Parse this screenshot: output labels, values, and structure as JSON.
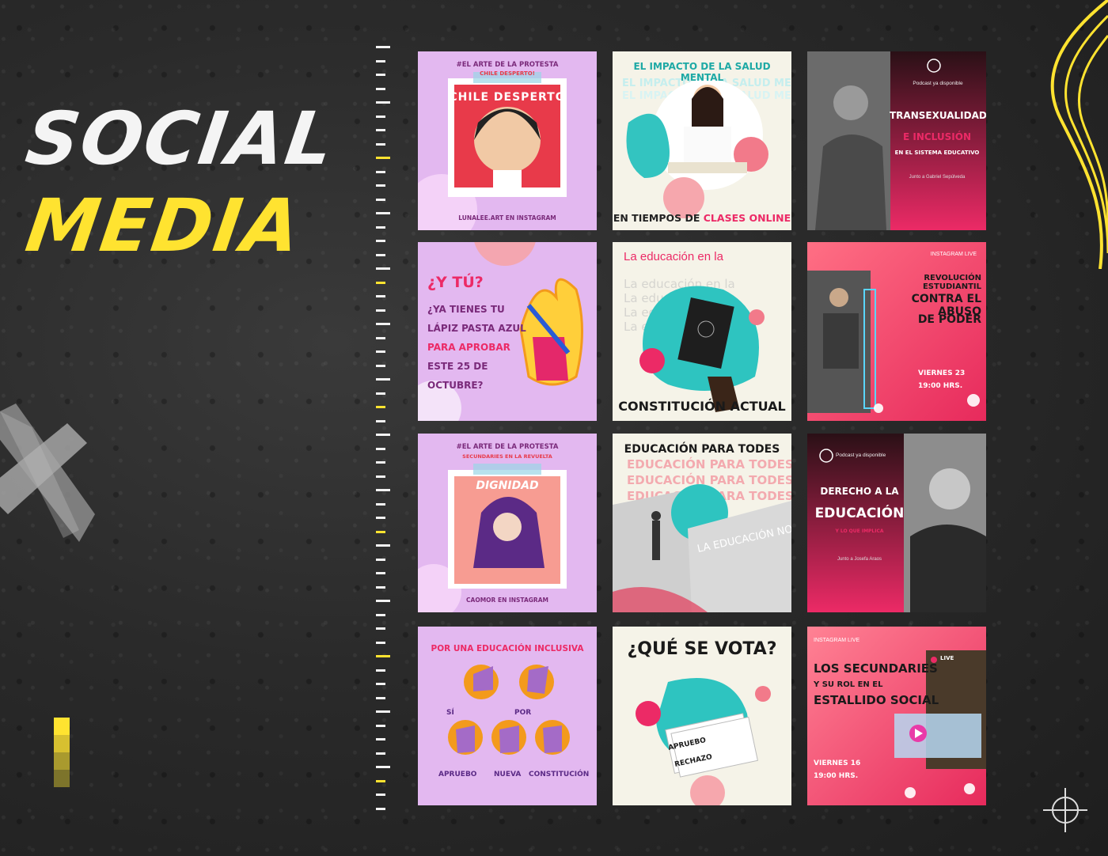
{
  "header": {
    "title_line1": "SOCIAL",
    "title_line2": "MEDIA"
  },
  "colors": {
    "accent_yellow": "#ffe330",
    "pink": "#ec2a66",
    "lilac": "#e6b4f0",
    "teal": "#2ec4c0",
    "cream": "#f5f3e8",
    "dark": "#1c1c1c"
  },
  "tiles": {
    "t1": {
      "hashtag": "#EL ARTE DE LA PROTESTA",
      "sub": "CHILE DESPERTO!",
      "art_text": "CHILE DESPERTO",
      "footer": "LUNALEE.ART EN INSTAGRAM"
    },
    "t2": {
      "headline": "EL IMPACTO DE LA SALUD MENTAL",
      "footer_a": "EN TIEMPOS DE ",
      "footer_b": "CLASES ONLINE"
    },
    "t3": {
      "badge": "Podcast ya disponible",
      "line1": "TRANSEXUALIDAD",
      "line2": "E INCLUSIÓN",
      "line3": "EN EL SISTEMA EDUCATIVO",
      "credit": "Junto a Gabriel Sepúlveda"
    },
    "t4": {
      "q": "¿Y TÚ?",
      "l1": "¿YA TIENES TU",
      "l2": "LÁPIZ PASTA AZUL",
      "l3": "PARA APROBAR",
      "l4": "ESTE 25 DE",
      "l5": "OCTUBRE?"
    },
    "t5": {
      "headline": "La educación en la",
      "footer": "CONSTITUCIÓN ACTUAL"
    },
    "t6": {
      "badge": "INSTAGRAM LIVE",
      "l1": "REVOLUCIÓN ESTUDIANTIL",
      "l2": "CONTRA EL ABUSO",
      "l3": "DE PODER",
      "date": "VIERNES 23",
      "time": "19:00 HRS."
    },
    "t7": {
      "hashtag": "#EL ARTE DE LA PROTESTA",
      "sub": "SECUNDARIES EN LA REVUELTA",
      "art_text": "DIGNIDAD",
      "footer": "CAOMOR EN INSTAGRAM"
    },
    "t8": {
      "headline": "EDUCACIÓN PARA TODES",
      "wall": "LA EDUCACIÓN NO SE VENDE"
    },
    "t9": {
      "badge": "Podcast ya disponible",
      "l1": "DERECHO A LA",
      "l2": "EDUCACIÓN",
      "l3": "Y LO QUE IMPLICA",
      "credit": "Junto a Josefa Araos"
    },
    "t10": {
      "headline": "POR UNA EDUCACIÓN INCLUSIVA",
      "signs": [
        "SÍ",
        "POR",
        "APRUEBO",
        "NUEVA",
        "CONSTITUCIÓN"
      ]
    },
    "t11": {
      "headline": "¿QUÉ SE VOTA?",
      "opt1": "APRUEBO",
      "opt2": "RECHAZO"
    },
    "t12": {
      "badge": "INSTAGRAM LIVE",
      "l1": "LOS SECUNDARIES",
      "l2": "Y SU ROL EN EL",
      "l3": "ESTALLIDO SOCIAL",
      "date": "VIERNES 16",
      "time": "19:00 HRS.",
      "live": "LIVE"
    }
  }
}
